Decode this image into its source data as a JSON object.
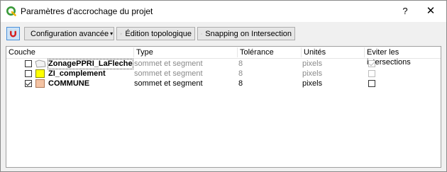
{
  "window": {
    "title": "Paramètres d'accrochage du projet",
    "help_label": "?",
    "close_label": "✕"
  },
  "toolbar": {
    "magnet_icon": "magnet-icon",
    "config_label": "Configuration avancée",
    "topo_label": "Édition topologique",
    "snapping_label": "Snapping on Intersection"
  },
  "table": {
    "headers": [
      "Couche",
      "Type",
      "Tolérance",
      "Unités",
      "Eviter les intersections"
    ],
    "rows": [
      {
        "checked": false,
        "name": "ZonagePPRI_LaFleche",
        "type": "sommet et segment",
        "tolerance": "8",
        "units": "pixels",
        "avoid": true,
        "enabled": false,
        "symbol": "polygon-outline-icon",
        "color": "#d9d9d9"
      },
      {
        "checked": false,
        "name": "ZI_complement",
        "type": "sommet et segment",
        "tolerance": "8",
        "units": "pixels",
        "avoid": false,
        "enabled": false,
        "symbol": "fill-swatch",
        "color": "#ffff00"
      },
      {
        "checked": true,
        "name": "COMMUNE",
        "type": "sommet et segment",
        "tolerance": "8",
        "units": "pixels",
        "avoid": false,
        "enabled": true,
        "symbol": "fill-swatch",
        "color": "#f4c3a3"
      }
    ]
  },
  "colors": {
    "accent": "#4a90d9",
    "qgis_green": "#3a9a3a"
  }
}
